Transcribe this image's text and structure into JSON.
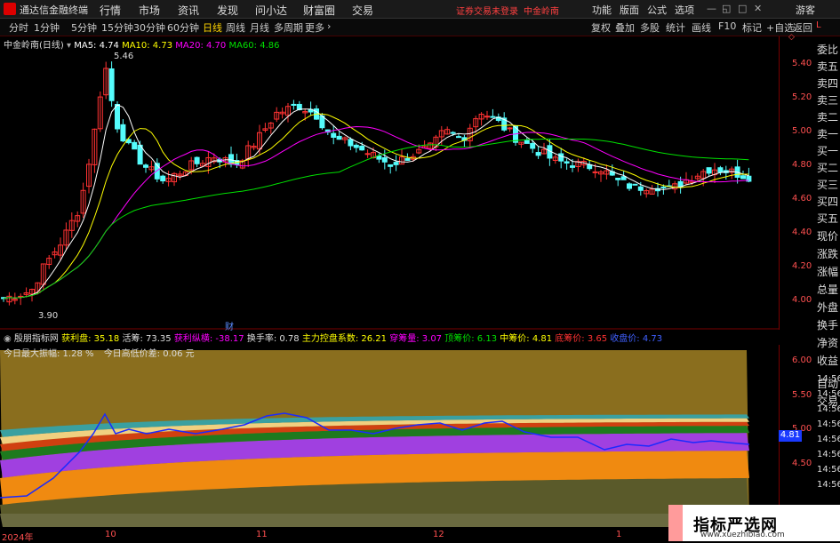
{
  "menubar": {
    "app_title": "通达信金融终端",
    "items": [
      "行情",
      "市场",
      "资讯",
      "发现",
      "问小达",
      "财富圈",
      "交易"
    ],
    "warning": "证券交易未登录",
    "stock_name": "中金岭南",
    "right_items": [
      "功能",
      "版面",
      "公式",
      "选项"
    ],
    "guest": "游客"
  },
  "tabs": [
    "分时",
    "1分钟",
    "5分钟",
    "15分钟",
    "30分钟",
    "60分钟",
    "日线",
    "周线",
    "月线",
    "多周期",
    "更多"
  ],
  "active_tab": "日线",
  "right_tabs": [
    "复权",
    "叠加",
    "多股",
    "统计",
    "画线",
    "F10",
    "标记",
    "+自选",
    "返回"
  ],
  "main_info": {
    "stock_label": "中金岭南(日线)",
    "ma5": "MA5: 4.74",
    "ma10": "MA10: 4.73",
    "ma20": "MA20: 4.70",
    "ma60": "MA60: 4.86"
  },
  "price_axis": [
    "5.40",
    "5.20",
    "5.00",
    "4.80",
    "4.60",
    "4.40",
    "4.20",
    "4.00"
  ],
  "high_label": "5.46",
  "low_label": "3.90",
  "fin_label": "财",
  "indicator_header": {
    "name": "殷朋指标网",
    "profit": "获利盘: 35.18",
    "active": "活筹: 73.35",
    "profit_ratio": "获利纵横: -38.17",
    "turnover": "换手率: 0.78",
    "main_ctrl": "主力控盘系数: 26.21",
    "pass_volume": "穿筹量: 3.07",
    "top_price": "顶筹价: 6.13",
    "mid_price": "中筹价: 4.81",
    "bottom_price": "底筹价: 3.65",
    "close_price": "收盘价: 4.73"
  },
  "indicator_sub": {
    "max_amp": "今日最大振幅: 1.28 %",
    "hl_diff": "今日高低价差: 0.06 元"
  },
  "ind_axis": [
    "6.00",
    "5.50",
    "5.00",
    "4.50"
  ],
  "ind_current": "4.81",
  "sidebar": [
    "委比",
    "卖五",
    "卖四",
    "卖三",
    "卖二",
    "卖一",
    "买一",
    "买二",
    "买三",
    "买四",
    "买五",
    "现价",
    "涨跌",
    "涨幅",
    "总量",
    "外盘",
    "换手",
    "净资",
    "收益",
    "自动",
    "交易"
  ],
  "side_times": [
    "14:56",
    "14:56",
    "14:56",
    "14:56",
    "14:56",
    "14:56",
    "14:56",
    "14:56"
  ],
  "bottom_axis": [
    "2024年",
    "10",
    "11",
    "12",
    "1"
  ],
  "watermark": {
    "title": "指标严选网",
    "url": "www.xuezhibiao.com"
  },
  "colors": {
    "up": "#ff3232",
    "down": "#54fcfc",
    "ma5": "#ffffff",
    "ma10": "#ffff00",
    "ma20": "#ff00ff",
    "ma60": "#00e000"
  }
}
